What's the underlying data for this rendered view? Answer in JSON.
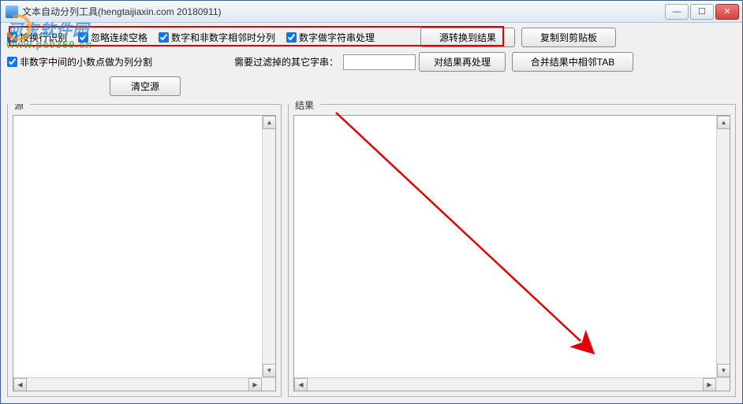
{
  "window": {
    "title": "文本自动分列工具(hengtaijiaxin.com 20180911)"
  },
  "watermark": {
    "line1": "河东软件园",
    "line2": "www.pc0359.cn"
  },
  "checkboxes": {
    "by_newline": "按换行识别",
    "ignore_spaces": "忽略连续空格",
    "digit_nondigit": "数字和非数字相邻时分列",
    "digit_as_string": "数字做字符串处理",
    "decimal_split": "非数字中间的小数点做为列分割"
  },
  "labels": {
    "filter_chars": "需要过滤掉的其它字串：",
    "source": "源",
    "result": "结果"
  },
  "inputs": {
    "filter_value": ""
  },
  "buttons": {
    "source_to_result": "源转换到结果",
    "copy_clipboard": "复制到剪贴板",
    "reprocess": "对结果再处理",
    "merge_tab": "合并结果中相邻TAB",
    "clear_source": "清空源"
  },
  "textareas": {
    "source": "",
    "result": ""
  }
}
